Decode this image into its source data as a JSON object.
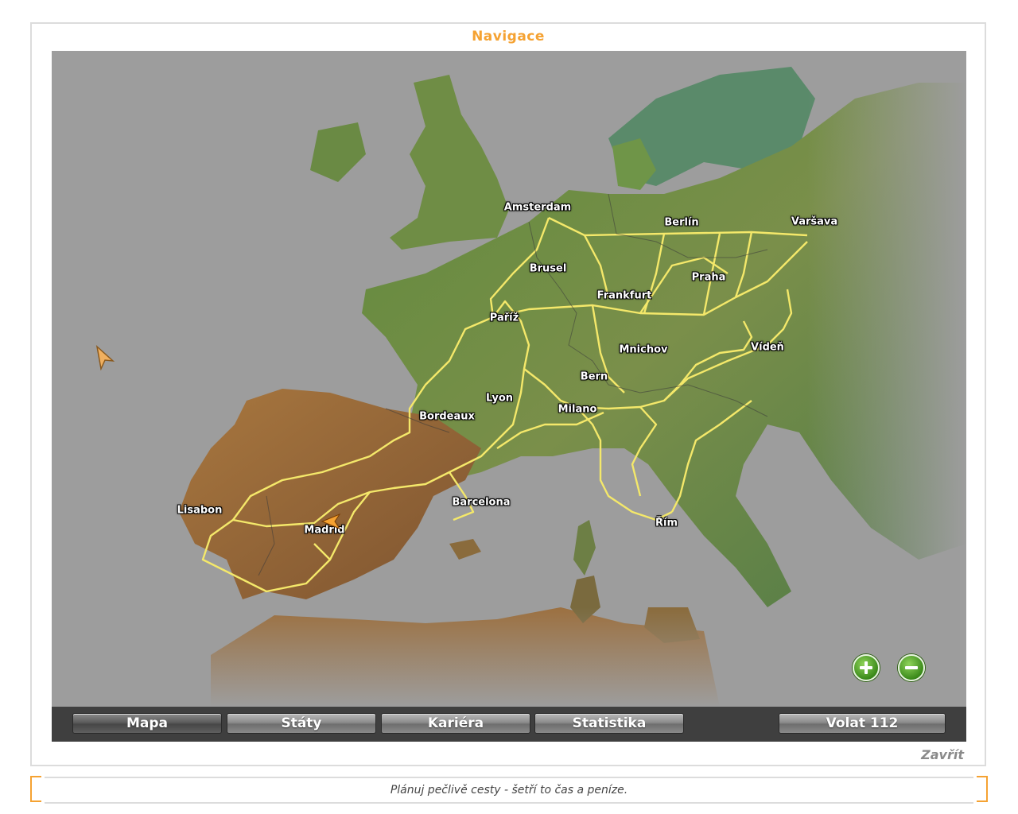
{
  "window": {
    "title": "Navigace",
    "close_label": "Zavřít"
  },
  "map": {
    "cities": [
      {
        "name": "Amsterdam"
      },
      {
        "name": "Berlín"
      },
      {
        "name": "Varšava"
      },
      {
        "name": "Brusel"
      },
      {
        "name": "Praha"
      },
      {
        "name": "Frankfurt"
      },
      {
        "name": "Paříž"
      },
      {
        "name": "Mnichov"
      },
      {
        "name": "Vídeň"
      },
      {
        "name": "Bern"
      },
      {
        "name": "Lyon"
      },
      {
        "name": "Bordeaux"
      },
      {
        "name": "Milano"
      },
      {
        "name": "Lisabon"
      },
      {
        "name": "Madrid"
      },
      {
        "name": "Barcelona"
      },
      {
        "name": "Řím"
      }
    ],
    "current_location": "Madrid",
    "colors": {
      "sea": "#9d9d9d",
      "land": "#6f8a45",
      "iberia": "#9a6a3a",
      "roads": "#f4e86a",
      "player": "#f5a232"
    }
  },
  "zoom": {
    "in_icon": "plus-circle-icon",
    "out_icon": "minus-circle-icon"
  },
  "toolbar": {
    "buttons": [
      {
        "label": "Mapa",
        "active": true
      },
      {
        "label": "Státy"
      },
      {
        "label": "Kariéra"
      },
      {
        "label": "Statistika"
      },
      {
        "label": "Volat 112"
      }
    ]
  },
  "tip": "Plánuj pečlivě cesty - šetří to čas a peníze."
}
